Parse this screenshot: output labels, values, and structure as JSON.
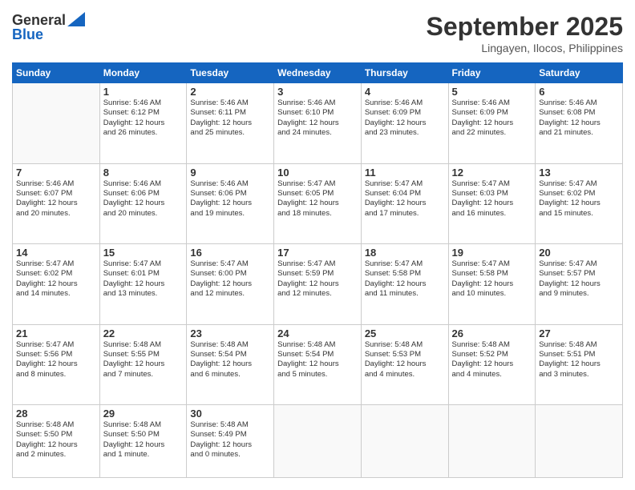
{
  "header": {
    "logo_line1": "General",
    "logo_line2": "Blue",
    "month": "September 2025",
    "location": "Lingayen, Ilocos, Philippines"
  },
  "weekdays": [
    "Sunday",
    "Monday",
    "Tuesday",
    "Wednesday",
    "Thursday",
    "Friday",
    "Saturday"
  ],
  "weeks": [
    [
      {
        "day": "",
        "info": ""
      },
      {
        "day": "1",
        "info": "Sunrise: 5:46 AM\nSunset: 6:12 PM\nDaylight: 12 hours\nand 26 minutes."
      },
      {
        "day": "2",
        "info": "Sunrise: 5:46 AM\nSunset: 6:11 PM\nDaylight: 12 hours\nand 25 minutes."
      },
      {
        "day": "3",
        "info": "Sunrise: 5:46 AM\nSunset: 6:10 PM\nDaylight: 12 hours\nand 24 minutes."
      },
      {
        "day": "4",
        "info": "Sunrise: 5:46 AM\nSunset: 6:09 PM\nDaylight: 12 hours\nand 23 minutes."
      },
      {
        "day": "5",
        "info": "Sunrise: 5:46 AM\nSunset: 6:09 PM\nDaylight: 12 hours\nand 22 minutes."
      },
      {
        "day": "6",
        "info": "Sunrise: 5:46 AM\nSunset: 6:08 PM\nDaylight: 12 hours\nand 21 minutes."
      }
    ],
    [
      {
        "day": "7",
        "info": "Sunrise: 5:46 AM\nSunset: 6:07 PM\nDaylight: 12 hours\nand 20 minutes."
      },
      {
        "day": "8",
        "info": "Sunrise: 5:46 AM\nSunset: 6:06 PM\nDaylight: 12 hours\nand 20 minutes."
      },
      {
        "day": "9",
        "info": "Sunrise: 5:46 AM\nSunset: 6:06 PM\nDaylight: 12 hours\nand 19 minutes."
      },
      {
        "day": "10",
        "info": "Sunrise: 5:47 AM\nSunset: 6:05 PM\nDaylight: 12 hours\nand 18 minutes."
      },
      {
        "day": "11",
        "info": "Sunrise: 5:47 AM\nSunset: 6:04 PM\nDaylight: 12 hours\nand 17 minutes."
      },
      {
        "day": "12",
        "info": "Sunrise: 5:47 AM\nSunset: 6:03 PM\nDaylight: 12 hours\nand 16 minutes."
      },
      {
        "day": "13",
        "info": "Sunrise: 5:47 AM\nSunset: 6:02 PM\nDaylight: 12 hours\nand 15 minutes."
      }
    ],
    [
      {
        "day": "14",
        "info": "Sunrise: 5:47 AM\nSunset: 6:02 PM\nDaylight: 12 hours\nand 14 minutes."
      },
      {
        "day": "15",
        "info": "Sunrise: 5:47 AM\nSunset: 6:01 PM\nDaylight: 12 hours\nand 13 minutes."
      },
      {
        "day": "16",
        "info": "Sunrise: 5:47 AM\nSunset: 6:00 PM\nDaylight: 12 hours\nand 12 minutes."
      },
      {
        "day": "17",
        "info": "Sunrise: 5:47 AM\nSunset: 5:59 PM\nDaylight: 12 hours\nand 12 minutes."
      },
      {
        "day": "18",
        "info": "Sunrise: 5:47 AM\nSunset: 5:58 PM\nDaylight: 12 hours\nand 11 minutes."
      },
      {
        "day": "19",
        "info": "Sunrise: 5:47 AM\nSunset: 5:58 PM\nDaylight: 12 hours\nand 10 minutes."
      },
      {
        "day": "20",
        "info": "Sunrise: 5:47 AM\nSunset: 5:57 PM\nDaylight: 12 hours\nand 9 minutes."
      }
    ],
    [
      {
        "day": "21",
        "info": "Sunrise: 5:47 AM\nSunset: 5:56 PM\nDaylight: 12 hours\nand 8 minutes."
      },
      {
        "day": "22",
        "info": "Sunrise: 5:48 AM\nSunset: 5:55 PM\nDaylight: 12 hours\nand 7 minutes."
      },
      {
        "day": "23",
        "info": "Sunrise: 5:48 AM\nSunset: 5:54 PM\nDaylight: 12 hours\nand 6 minutes."
      },
      {
        "day": "24",
        "info": "Sunrise: 5:48 AM\nSunset: 5:54 PM\nDaylight: 12 hours\nand 5 minutes."
      },
      {
        "day": "25",
        "info": "Sunrise: 5:48 AM\nSunset: 5:53 PM\nDaylight: 12 hours\nand 4 minutes."
      },
      {
        "day": "26",
        "info": "Sunrise: 5:48 AM\nSunset: 5:52 PM\nDaylight: 12 hours\nand 4 minutes."
      },
      {
        "day": "27",
        "info": "Sunrise: 5:48 AM\nSunset: 5:51 PM\nDaylight: 12 hours\nand 3 minutes."
      }
    ],
    [
      {
        "day": "28",
        "info": "Sunrise: 5:48 AM\nSunset: 5:50 PM\nDaylight: 12 hours\nand 2 minutes."
      },
      {
        "day": "29",
        "info": "Sunrise: 5:48 AM\nSunset: 5:50 PM\nDaylight: 12 hours\nand 1 minute."
      },
      {
        "day": "30",
        "info": "Sunrise: 5:48 AM\nSunset: 5:49 PM\nDaylight: 12 hours\nand 0 minutes."
      },
      {
        "day": "",
        "info": ""
      },
      {
        "day": "",
        "info": ""
      },
      {
        "day": "",
        "info": ""
      },
      {
        "day": "",
        "info": ""
      }
    ]
  ]
}
